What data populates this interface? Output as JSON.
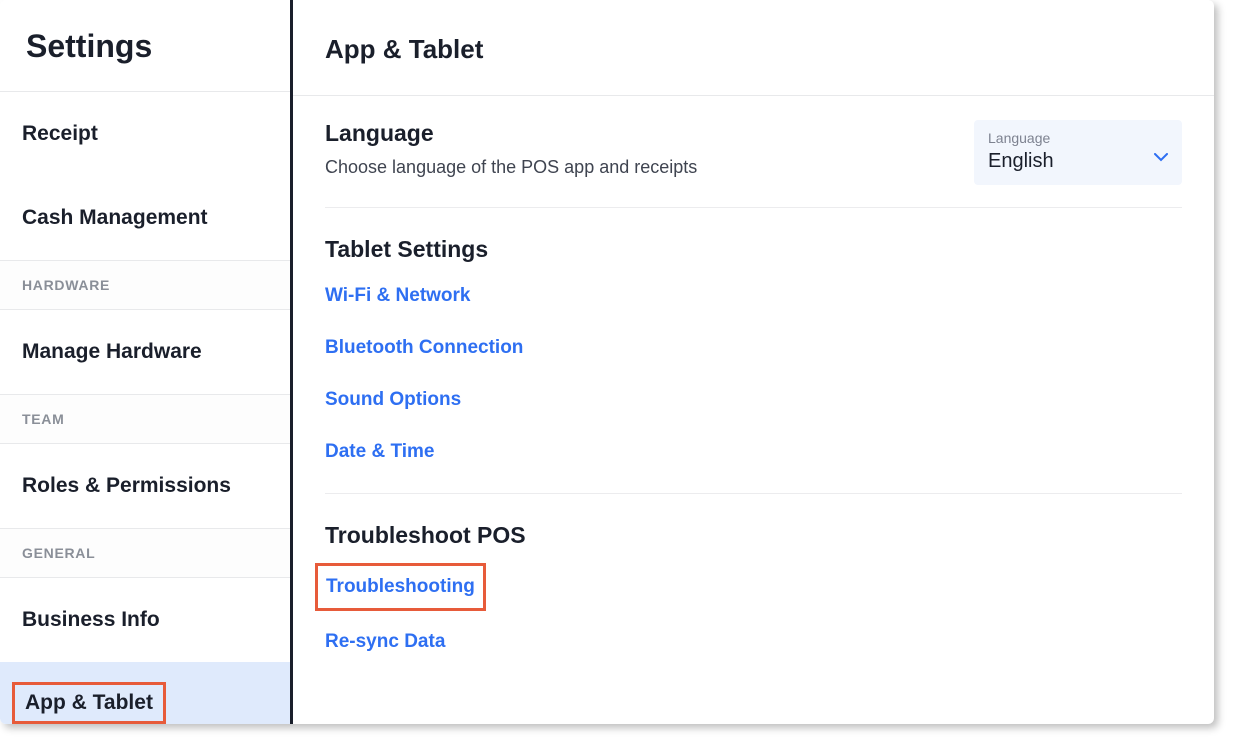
{
  "sidebar": {
    "title": "Settings",
    "items": [
      {
        "label": "Receipt",
        "type": "item"
      },
      {
        "label": "Cash Management",
        "type": "item"
      },
      {
        "label": "HARDWARE",
        "type": "section"
      },
      {
        "label": "Manage Hardware",
        "type": "item"
      },
      {
        "label": "TEAM",
        "type": "section"
      },
      {
        "label": "Roles & Permissions",
        "type": "item"
      },
      {
        "label": "GENERAL",
        "type": "section"
      },
      {
        "label": "Business Info",
        "type": "item"
      },
      {
        "label": "App & Tablet",
        "type": "item",
        "active": true,
        "highlighted": true
      }
    ]
  },
  "main": {
    "title": "App & Tablet",
    "language_section": {
      "heading": "Language",
      "description": "Choose language of the POS app and receipts",
      "dropdown_label": "Language",
      "dropdown_value": "English"
    },
    "tablet_section": {
      "heading": "Tablet Settings",
      "links": [
        "Wi-Fi & Network",
        "Bluetooth Connection",
        "Sound Options",
        "Date & Time"
      ]
    },
    "troubleshoot_section": {
      "heading": "Troubleshoot POS",
      "links": [
        {
          "label": "Troubleshooting",
          "highlighted": true
        },
        {
          "label": "Re-sync Data",
          "highlighted": false
        }
      ]
    }
  }
}
